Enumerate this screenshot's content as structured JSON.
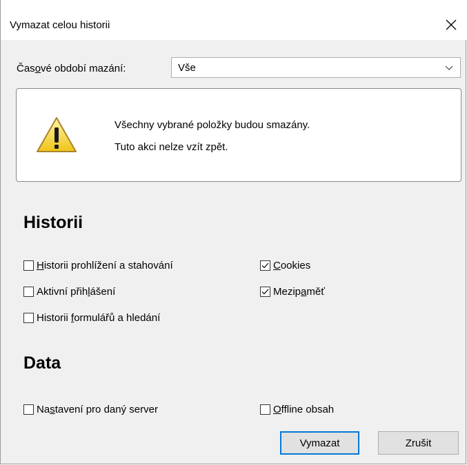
{
  "dialog": {
    "title": "Vymazat celou historii",
    "close_label": "✕"
  },
  "time_range": {
    "label_prefix": "Čas",
    "label_accel": "o",
    "label_suffix": "vé období mazání:",
    "selected": "Vše"
  },
  "warning": {
    "icon": "warning-icon",
    "line1": "Všechny vybrané položky budou smazány.",
    "line2": "Tuto akci nelze vzít zpět."
  },
  "history": {
    "heading": "Historii",
    "items": [
      {
        "pre": "",
        "accel": "H",
        "post": "istorii prohlížení a stahování",
        "checked": false
      },
      {
        "pre": "Aktivní přih",
        "accel": "l",
        "post": "ášení",
        "checked": false
      },
      {
        "pre": "Historii ",
        "accel": "f",
        "post": "ormulářů a hledání",
        "checked": false
      },
      {
        "pre": "",
        "accel": "C",
        "post": "ookies",
        "checked": true
      },
      {
        "pre": "Mezip",
        "accel": "a",
        "post": "měť",
        "checked": true
      }
    ]
  },
  "data_section": {
    "heading": "Data",
    "items": [
      {
        "pre": "Na",
        "accel": "s",
        "post": "tavení pro daný server",
        "checked": false
      },
      {
        "pre": "",
        "accel": "O",
        "post": "ffline obsah",
        "checked": false
      }
    ]
  },
  "buttons": {
    "confirm": "Vymazat",
    "cancel": "Zrušit"
  },
  "colors": {
    "focus_border": "#0078d7",
    "dialog_bg": "#f0f0f0"
  }
}
